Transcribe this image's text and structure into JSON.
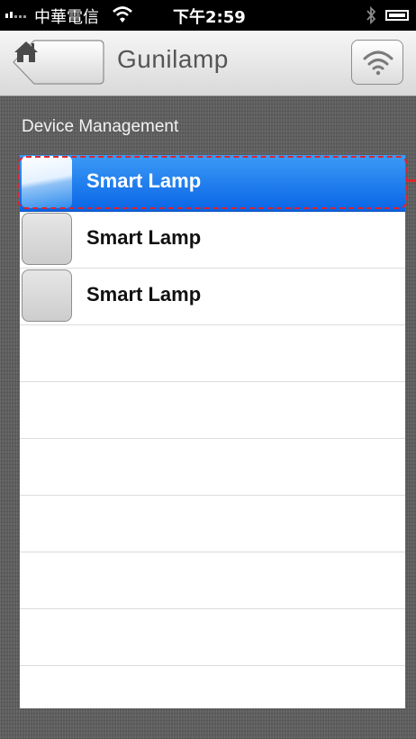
{
  "status_bar": {
    "carrier": "中華電信",
    "time": "下午2:59"
  },
  "nav_bar": {
    "title": "Gunilamp"
  },
  "section": {
    "header": "Device Management"
  },
  "devices": [
    {
      "label": "Smart Lamp",
      "selected": true
    },
    {
      "label": "Smart Lamp",
      "selected": false
    },
    {
      "label": "Smart Lamp",
      "selected": false
    }
  ],
  "colors": {
    "selection_blue": "#0a64e6",
    "highlight_red": "#e0242b"
  }
}
